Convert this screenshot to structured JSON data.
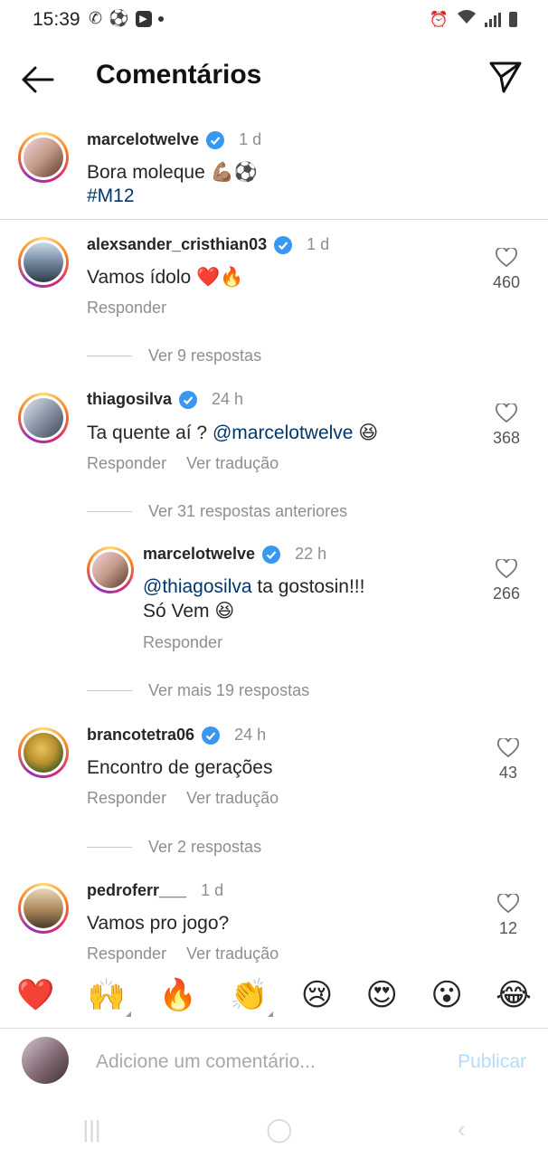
{
  "status_bar": {
    "time": "15:39"
  },
  "header": {
    "title": "Comentários"
  },
  "caption": {
    "username": "marcelotwelve",
    "time": "1 d",
    "text": "Bora moleque 💪🏽⚽",
    "hashtag": "#M12"
  },
  "comments": [
    {
      "username": "alexsander_cristhian03",
      "time": "1 d",
      "text": "Vamos ídolo ❤️🔥",
      "likes": "460",
      "reply": "Responder",
      "more": "Ver 9 respostas"
    },
    {
      "username": "thiagosilva",
      "time": "24 h",
      "text_plain": "Ta quente aí ? ",
      "mention": "@marcelotwelve",
      "emoji": " 😆",
      "likes": "368",
      "reply": "Responder",
      "translate": "Ver tradução",
      "more": "Ver 31 respostas anteriores"
    },
    {
      "username": "marcelotwelve",
      "time": "22 h",
      "mention": "@thiagosilva",
      "text_plain": " ta gostosin!!!",
      "line2": "Só Vem 😆",
      "likes": "266",
      "reply": "Responder",
      "more": "Ver mais 19 respostas"
    },
    {
      "username": "brancotetra06",
      "time": "24 h",
      "text": "Encontro de gerações",
      "likes": "43",
      "reply": "Responder",
      "translate": "Ver tradução",
      "more": "Ver 2 respostas"
    },
    {
      "username": "pedroferr___",
      "time": "1 d",
      "text": "Vamos pro jogo?",
      "likes": "12",
      "reply": "Responder",
      "translate": "Ver tradução"
    }
  ],
  "reactions": [
    "❤️",
    "🙌",
    "🔥",
    "👏",
    "😢",
    "😍",
    "😮",
    "😂"
  ],
  "composer": {
    "placeholder": "Adicione um comentário...",
    "publish": "Publicar"
  },
  "colors": {
    "accent_blue": "#0095f6",
    "verified": "#3897f0",
    "muted": "#8e8e8e"
  }
}
